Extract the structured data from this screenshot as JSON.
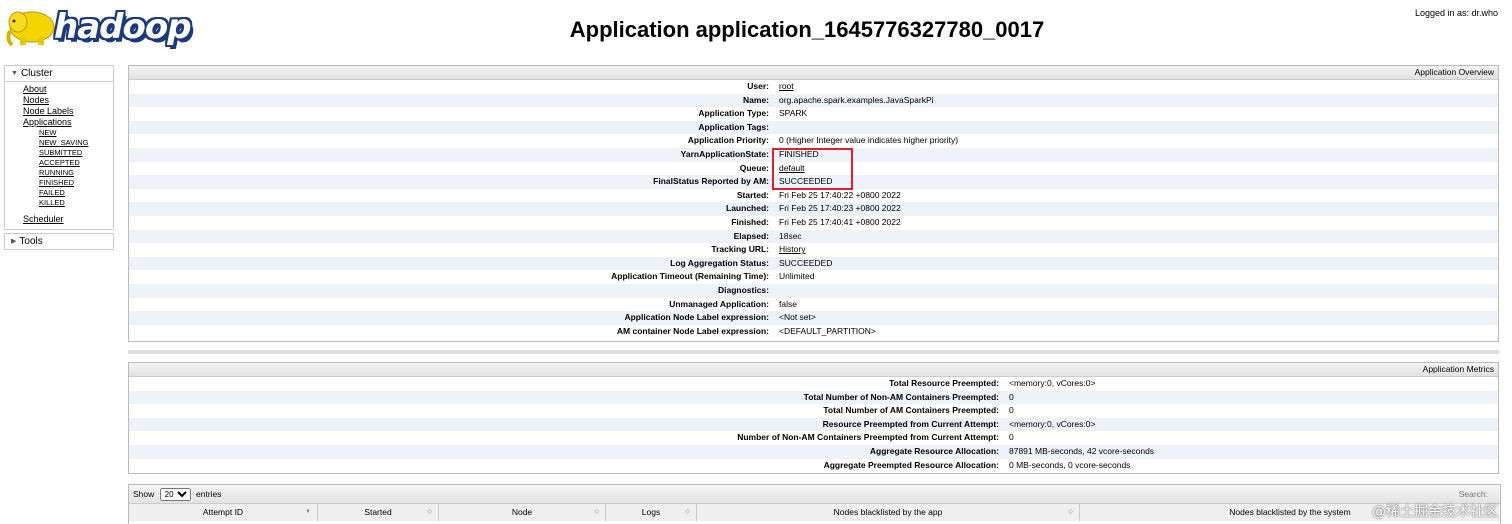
{
  "header": {
    "logo_text": "hadoop",
    "title": "Application application_1645776327780_0017",
    "logged_in": "Logged in as: dr.who"
  },
  "nav": {
    "cluster_label": "Cluster",
    "links": [
      "About",
      "Nodes",
      "Node Labels",
      "Applications"
    ],
    "app_states": [
      "NEW",
      "NEW_SAVING",
      "SUBMITTED",
      "ACCEPTED",
      "RUNNING",
      "FINISHED",
      "FAILED",
      "KILLED"
    ],
    "scheduler": "Scheduler",
    "tools_label": "Tools"
  },
  "overview": {
    "heading": "Application Overview",
    "rows": [
      {
        "k": "User:",
        "v": "root"
      },
      {
        "k": "Name:",
        "v": "org.apache.spark.examples.JavaSparkPi"
      },
      {
        "k": "Application Type:",
        "v": "SPARK"
      },
      {
        "k": "Application Tags:",
        "v": ""
      },
      {
        "k": "Application Priority:",
        "v": "0 (Higher Integer value indicates higher priority)"
      },
      {
        "k": "YarnApplicationState:",
        "v": "FINISHED"
      },
      {
        "k": "Queue:",
        "v": "default"
      },
      {
        "k": "FinalStatus Reported by AM:",
        "v": "SUCCEEDED"
      },
      {
        "k": "Started:",
        "v": "Fri Feb 25 17:40:22 +0800 2022"
      },
      {
        "k": "Launched:",
        "v": "Fri Feb 25 17:40:23 +0800 2022"
      },
      {
        "k": "Finished:",
        "v": "Fri Feb 25 17:40:41 +0800 2022"
      },
      {
        "k": "Elapsed:",
        "v": "18sec"
      },
      {
        "k": "Tracking URL:",
        "v": "History"
      },
      {
        "k": "Log Aggregation Status:",
        "v": "SUCCEEDED"
      },
      {
        "k": "Application Timeout (Remaining Time):",
        "v": "Unlimited"
      },
      {
        "k": "Diagnostics:",
        "v": ""
      },
      {
        "k": "Unmanaged Application:",
        "v": "false"
      },
      {
        "k": "Application Node Label expression:",
        "v": "<Not set>"
      },
      {
        "k": "AM container Node Label expression:",
        "v": "<DEFAULT_PARTITION>"
      }
    ]
  },
  "metrics": {
    "heading": "Application Metrics",
    "rows": [
      {
        "k": "Total Resource Preempted:",
        "v": "<memory:0, vCores:0>"
      },
      {
        "k": "Total Number of Non-AM Containers Preempted:",
        "v": "0"
      },
      {
        "k": "Total Number of AM Containers Preempted:",
        "v": "0"
      },
      {
        "k": "Resource Preempted from Current Attempt:",
        "v": "<memory:0, vCores:0>"
      },
      {
        "k": "Number of Non-AM Containers Preempted from Current Attempt:",
        "v": "0"
      },
      {
        "k": "Aggregate Resource Allocation:",
        "v": "87891 MB-seconds, 42 vcore-seconds"
      },
      {
        "k": "Aggregate Preempted Resource Allocation:",
        "v": "0 MB-seconds, 0 vcore-seconds"
      }
    ]
  },
  "attempts": {
    "show_label": "Show",
    "page_size": "20",
    "entries_label": "entries",
    "search_label": "Search:",
    "columns": [
      "Attempt ID",
      "Started",
      "Node",
      "Logs",
      "Nodes blacklisted by the app",
      "Nodes blacklisted by the system"
    ]
  },
  "watermark": "@稀土掘金技术社区"
}
